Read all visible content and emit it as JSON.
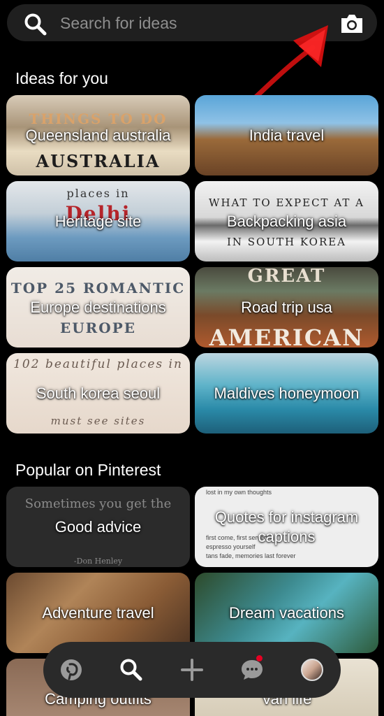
{
  "search": {
    "placeholder": "Search for ideas",
    "search_icon": "search-icon",
    "camera_icon": "camera-icon"
  },
  "sections": {
    "ideas_title": "Ideas for you",
    "popular_title": "Popular on Pinterest"
  },
  "ideas": [
    {
      "label": "Queensland australia",
      "deco": [
        "THINGS TO DO",
        "AUSTRALIA"
      ]
    },
    {
      "label": "India travel",
      "deco": []
    },
    {
      "label": "Heritage site",
      "deco": [
        "places in",
        "Delhi"
      ]
    },
    {
      "label": "Backpacking asia",
      "deco": [
        "WHAT TO EXPECT AT A",
        "IN SOUTH KOREA"
      ]
    },
    {
      "label": "Europe destinations",
      "deco": [
        "TOP 25 ROMANTIC",
        "EUROPE"
      ]
    },
    {
      "label": "Road trip usa",
      "deco": [
        "GREAT",
        "AMERICAN"
      ]
    },
    {
      "label": "South korea seoul",
      "deco": [
        "102 beautiful places in",
        "must see sites"
      ]
    },
    {
      "label": "Maldives honeymoon",
      "deco": []
    }
  ],
  "popular": [
    {
      "label": "Good advice",
      "deco": [
        "Sometimes you get the",
        "-Don Henley"
      ]
    },
    {
      "label": "Quotes for instagram captions",
      "deco": [
        "lost in my own thoughts",
        "first come, first served",
        "espresso yourself",
        "tans fade, memories last forever"
      ]
    },
    {
      "label": "Adventure travel",
      "deco": []
    },
    {
      "label": "Dream vacations",
      "deco": []
    },
    {
      "label": "Camping outfits",
      "deco": []
    },
    {
      "label": "Van life",
      "deco": []
    }
  ],
  "nav": {
    "items": [
      "pinterest-logo-icon",
      "search-icon",
      "plus-icon",
      "chat-icon",
      "profile-avatar"
    ],
    "notification_color": "#e60023"
  },
  "colors": {
    "background": "#000000",
    "search_bar": "#1f1f1f",
    "nav_bar": "#2a2a2a",
    "annotation_arrow": "#e01010"
  }
}
